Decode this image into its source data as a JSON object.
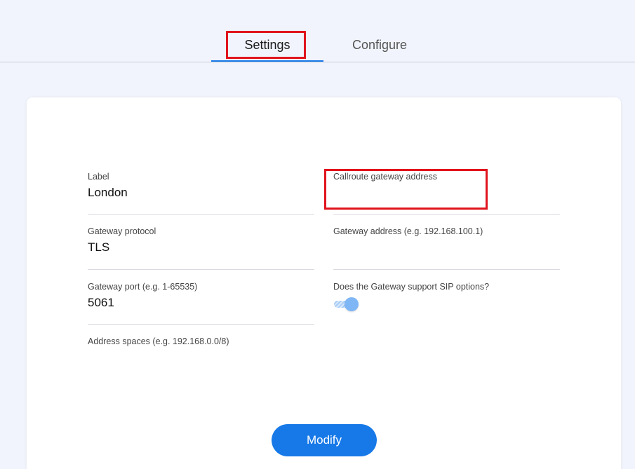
{
  "tabs": {
    "settings": "Settings",
    "configure": "Configure"
  },
  "form": {
    "label": {
      "label": "Label",
      "value": "London"
    },
    "callroute_address": {
      "label": "Callroute gateway address",
      "value": ""
    },
    "protocol": {
      "label": "Gateway protocol",
      "value": "TLS"
    },
    "gateway_address": {
      "label": "Gateway address (e.g. 192.168.100.1)",
      "value": ""
    },
    "port": {
      "label": "Gateway port (e.g. 1-65535)",
      "value": "5061"
    },
    "sip_options": {
      "label": "Does the Gateway support SIP options?",
      "enabled": true
    },
    "address_spaces": {
      "label": "Address spaces (e.g. 192.168.0.0/8)",
      "value": ""
    }
  },
  "actions": {
    "modify": "Modify"
  },
  "colors": {
    "accent": "#1779e8",
    "highlight": "#e0141d",
    "background": "#f1f4fc"
  }
}
